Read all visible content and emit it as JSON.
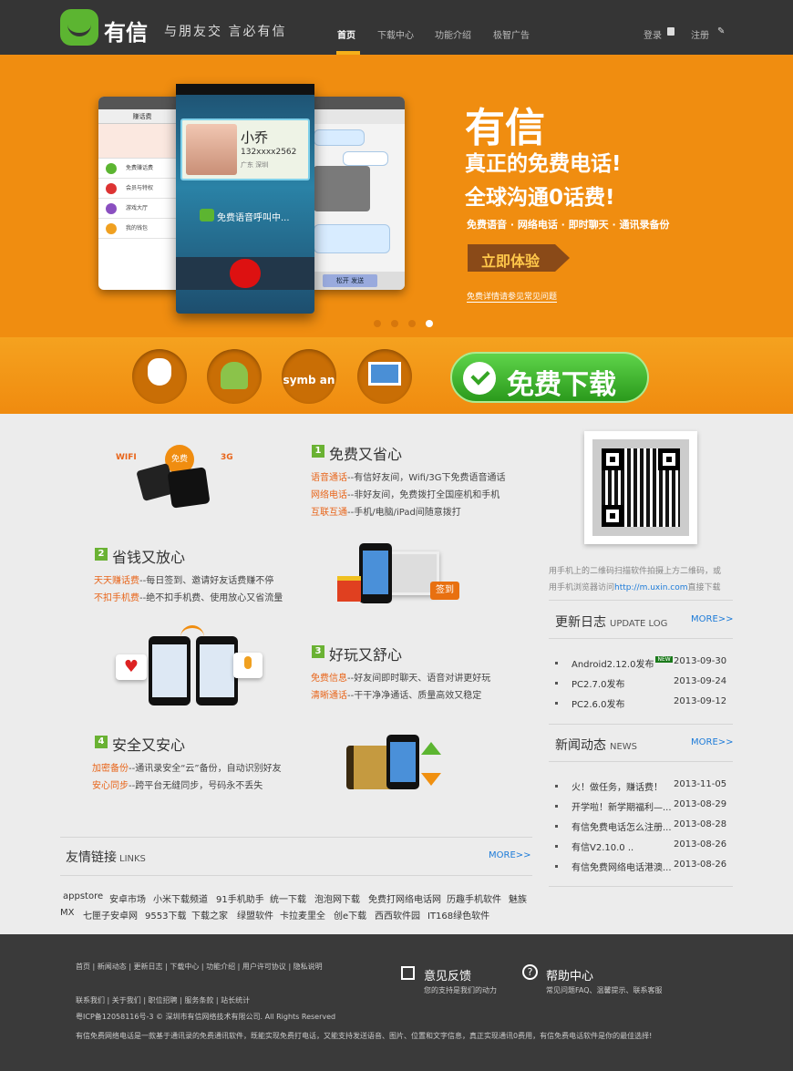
{
  "header": {
    "logo": "有信",
    "slogan": "与朋友交 言必有信",
    "nav": [
      {
        "label": "首页"
      },
      {
        "label": "下载中心"
      },
      {
        "label": "功能介绍"
      },
      {
        "label": "极智广告"
      }
    ],
    "login": "登录",
    "register": "注册"
  },
  "banner": {
    "phone_contact_name": "小乔",
    "phone_contact_number": "132xxxx2562",
    "phone_contact_location": "广东 深圳",
    "phone_call_text": "免费语音呼叫中...",
    "phone1_title": "赚话费",
    "phone1_items": [
      "免费赚话费",
      "会员与特权",
      "游戏大厅",
      "我的钱包"
    ],
    "phone3_send": "松开 发送",
    "title": "有信",
    "line1": "真正的免费电话!",
    "line2": "全球沟通0话费!",
    "features": "免费语音 · 网络电话 · 即时聊天 · 通讯录备份",
    "try_button": "立即体验",
    "faq_link": "免费详情请参见常见问题",
    "slide_count": 4,
    "active_slide": 4
  },
  "download": {
    "platforms": [
      "ios",
      "android",
      "symbian",
      "windows"
    ],
    "symbian_label": "symb an",
    "button": "免费下载"
  },
  "features": [
    {
      "num": "1",
      "title": "免费又省心",
      "lines": [
        {
          "key": "语音通话",
          "text": "--有信好友间，Wifi/3G下免费语音通话"
        },
        {
          "key": "网络电话",
          "text": "--非好友间，免费拨打全国座机和手机"
        },
        {
          "key": "互联互通",
          "text": "--手机/电脑/iPad间随意拨打"
        }
      ],
      "illustration_labels": [
        "WIFI",
        "免费",
        "3G"
      ]
    },
    {
      "num": "2",
      "title": "省钱又放心",
      "lines": [
        {
          "key": "天天赚话费",
          "text": "--每日签到、邀请好友话费赚不停"
        },
        {
          "key": "不扣手机费",
          "text": "--绝不扣手机费、使用放心又省流量"
        }
      ],
      "illustration_labels": [
        "签到"
      ]
    },
    {
      "num": "3",
      "title": "好玩又舒心",
      "lines": [
        {
          "key": "免费信息",
          "text": "--好友间即时聊天、语音对讲更好玩"
        },
        {
          "key": "清晰通话",
          "text": "--干干净净通话、质量高效又稳定"
        }
      ]
    },
    {
      "num": "4",
      "title": "安全又安心",
      "lines": [
        {
          "key": "加密备份",
          "text": "--通讯录安全“云”备份，自动识别好友"
        },
        {
          "key": "安心同步",
          "text": "--跨平台无缝同步，号码永不丢失"
        }
      ]
    }
  ],
  "qr": {
    "text1": "用手机上的二维码扫描软件拍摄上方二维码，或",
    "text2_prefix": "用手机浏览器访问",
    "text2_link": "http://m.uxin.com",
    "text2_suffix": "直接下载"
  },
  "update_log": {
    "title": "更新日志",
    "subtitle": "UPDATE LOG",
    "more": "MORE>>",
    "items": [
      {
        "text": "Android2.12.0发布",
        "new": "NEW",
        "date": "2013-09-30"
      },
      {
        "text": "PC2.7.0发布",
        "date": "2013-09-24"
      },
      {
        "text": "PC2.6.0发布",
        "date": "2013-09-12"
      }
    ]
  },
  "news": {
    "title": "新闻动态",
    "subtitle": "NEWS",
    "more": "MORE>>",
    "items": [
      {
        "text": "火！做任务，赚话费！",
        "date": "2013-11-05"
      },
      {
        "text": "开学啦！新学期福利—...",
        "date": "2013-08-29"
      },
      {
        "text": "有信免费电话怎么注册...",
        "date": "2013-08-28"
      },
      {
        "text": "有信V2.10.0 ..",
        "date": "2013-08-26"
      },
      {
        "text": "有信免费网络电话港澳...",
        "date": "2013-08-26"
      }
    ]
  },
  "links": {
    "title": "友情链接",
    "subtitle": "LINKS",
    "more": "MORE>>",
    "row1": [
      "appstore",
      "安卓市场",
      "小米下载频道",
      "91手机助手",
      "统一下载",
      "泡泡网下载",
      "免费打网络电话网",
      "历趣手机软件",
      "魅族"
    ],
    "row2": [
      "MX",
      "七匣子安卓网",
      "9553下载",
      "下载之家",
      "绿盟软件",
      "卡拉麦里全",
      "创e下载",
      "西西软件园",
      "IT168绿色软件"
    ]
  },
  "footer": {
    "links1": "首页 | 新闻动态 | 更新日志 | 下载中心 | 功能介绍 | 用户许可协议 | 隐私说明",
    "links2": "联系我们 | 关于我们 | 职位招聘 | 服务条款 | 站长统计",
    "icp": "粤ICP备12058116号-3 © 深圳市有信网络技术有限公司. All Rights Reserved",
    "desc": "有信免费网络电话是一款基于通讯录的免费通讯软件，既能实现免费打电话，又能支持发送语音、图片、位置和文字信息，真正实现通讯0费用，有信免费电话软件是你的最佳选择!",
    "feedback_title": "意见反馈",
    "feedback_sub": "您的支持是我们的动力",
    "help_title": "帮助中心",
    "help_sub": "常见问题FAQ、温馨提示、联系客服"
  },
  "colors": {
    "brand_green": "#5cb531",
    "banner_orange": "#f08d10",
    "link_blue": "#1d7bd8",
    "highlight_orange": "#e8651a",
    "header": "#353535"
  }
}
